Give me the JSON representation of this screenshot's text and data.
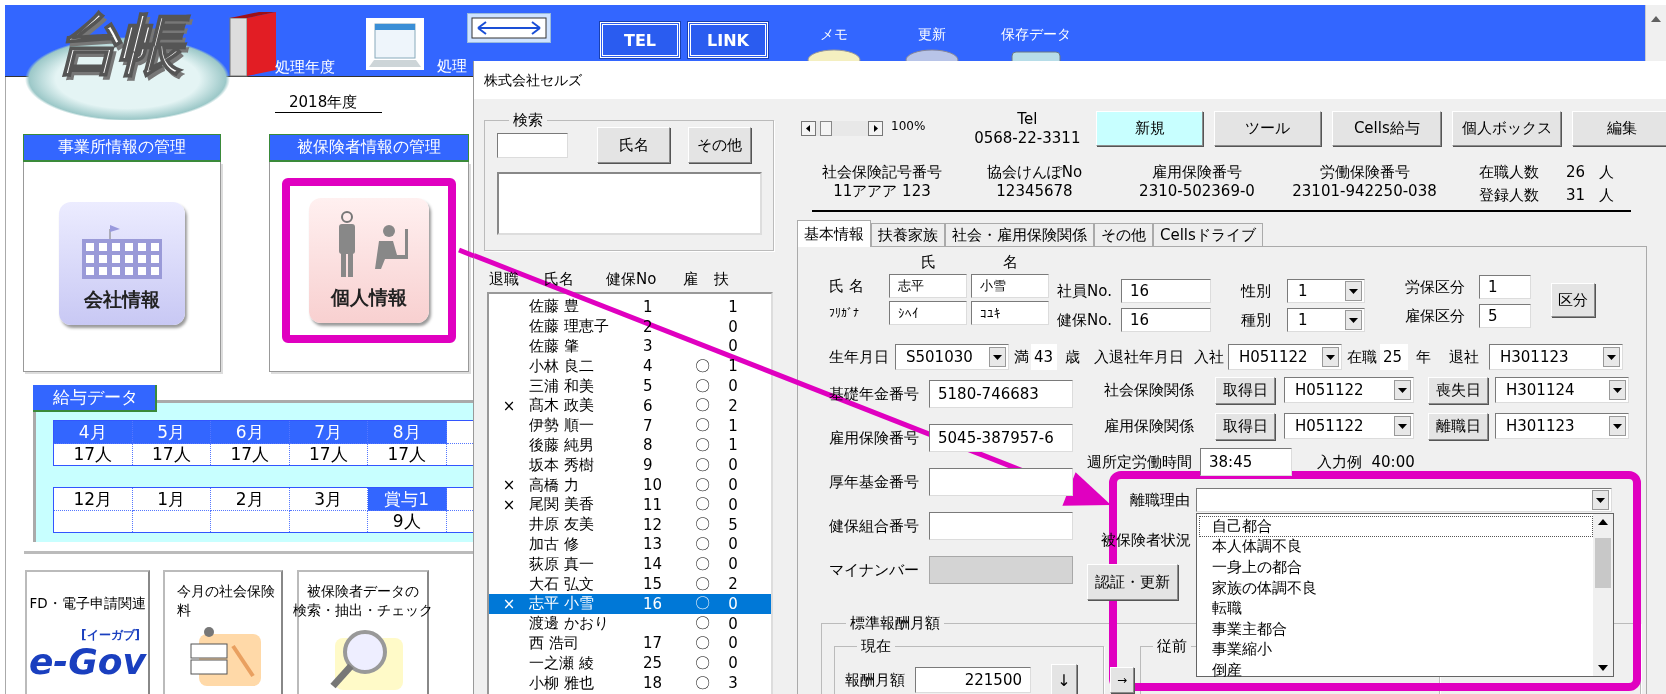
{
  "header": {
    "logo": "台帳",
    "year_label": "処理年度",
    "year_value": "2018年度",
    "ledger_label": "処理",
    "link_buttons": [
      "TEL",
      "LINK"
    ],
    "tools": [
      "メモ",
      "更新",
      "保存データ"
    ]
  },
  "management_cards": [
    {
      "title": "事業所情報の管理",
      "button": "会社情報",
      "kind": "company",
      "highlighted": false
    },
    {
      "title": "被保険者情報の管理",
      "button": "個人情報",
      "kind": "person",
      "highlighted": true
    }
  ],
  "salary_data": {
    "title": "給与データ",
    "tables": [
      {
        "cells": [
          {
            "month": "4月",
            "count": "17人",
            "highlighted": true
          },
          {
            "month": "5月",
            "count": "17人",
            "highlighted": true
          },
          {
            "month": "6月",
            "count": "17人",
            "highlighted": true
          },
          {
            "month": "7月",
            "count": "17人",
            "highlighted": true
          },
          {
            "month": "8月",
            "count": "17人",
            "highlighted": true
          }
        ]
      },
      {
        "cells": [
          {
            "month": "12月",
            "highlighted": false
          },
          {
            "month": "1月",
            "highlighted": false
          },
          {
            "month": "2月",
            "highlighted": false
          },
          {
            "month": "3月",
            "highlighted": false
          },
          {
            "month": "賞与1",
            "count": "9人",
            "highlighted": true
          }
        ]
      }
    ]
  },
  "menu_tiles": [
    {
      "label_lines": [
        "FD・電子申請関連"
      ],
      "kind": "egov",
      "logo": "e-Gov",
      "logo_reading": "[イーガブ]"
    },
    {
      "label_lines": [
        "今月の社会保険",
        "料"
      ],
      "kind": "premium"
    },
    {
      "label_lines": [
        "被保険者データの",
        "検索・抽出・チェック"
      ],
      "kind": "search"
    }
  ],
  "window": {
    "title": "株式会社セルズ",
    "search": {
      "label": "検索",
      "buttons": [
        "氏名",
        "その他"
      ]
    },
    "employee_list": {
      "columns": [
        "退職",
        "氏名",
        "健保No",
        "雇",
        "扶"
      ],
      "rows": [
        {
          "name": "佐藤 豊",
          "no": "1",
          "dependents": "1",
          "selected": false
        },
        {
          "name": "佐藤 理恵子",
          "no": "2",
          "dependents": "0",
          "selected": false
        },
        {
          "name": "佐藤 肇",
          "no": "3",
          "dependents": "0",
          "selected": false
        },
        {
          "name": "小林 良二",
          "no": "4",
          "employment": "〇",
          "dependents": "1",
          "selected": false
        },
        {
          "name": "三浦 和美",
          "no": "5",
          "employment": "〇",
          "dependents": "0",
          "selected": false
        },
        {
          "retired": "×",
          "name": "髙木 政美",
          "no": "6",
          "employment": "〇",
          "dependents": "2",
          "selected": false
        },
        {
          "name": "伊勢 順一",
          "no": "7",
          "employment": "〇",
          "dependents": "1",
          "selected": false
        },
        {
          "name": "後藤 純男",
          "no": "8",
          "employment": "〇",
          "dependents": "1",
          "selected": false
        },
        {
          "name": "坂本 秀樹",
          "no": "9",
          "employment": "〇",
          "dependents": "0",
          "selected": false
        },
        {
          "retired": "×",
          "name": "高橋 力",
          "no": "10",
          "employment": "〇",
          "dependents": "0",
          "selected": false
        },
        {
          "retired": "×",
          "name": "尾関 美香",
          "no": "11",
          "employment": "〇",
          "dependents": "0",
          "selected": false
        },
        {
          "name": "井原 友美",
          "no": "12",
          "employment": "〇",
          "dependents": "5",
          "selected": false
        },
        {
          "name": "加古 修",
          "no": "13",
          "employment": "〇",
          "dependents": "0",
          "selected": false
        },
        {
          "name": "荻原 真一",
          "no": "14",
          "employment": "〇",
          "dependents": "0",
          "selected": false
        },
        {
          "name": "大石 弘文",
          "no": "15",
          "employment": "〇",
          "dependents": "2",
          "selected": false
        },
        {
          "retired": "×",
          "name": "志平 小雪",
          "no": "16",
          "employment": "〇",
          "dependents": "0",
          "selected": true
        },
        {
          "name": "渡邊 かおり",
          "employment": "〇",
          "dependents": "0",
          "selected": false
        },
        {
          "name": "西 浩司",
          "no": "17",
          "employment": "〇",
          "dependents": "0",
          "selected": false
        },
        {
          "name": "一之瀬 綾",
          "no": "25",
          "employment": "〇",
          "dependents": "0",
          "selected": false
        },
        {
          "name": "小柳 雅也",
          "no": "18",
          "employment": "〇",
          "dependents": "3",
          "selected": false
        }
      ]
    },
    "zoom": "100%",
    "tel_label": "Tel",
    "tel": "0568-22-3311",
    "actions": [
      {
        "label": "新規",
        "highlighted": true
      },
      {
        "label": "ツール",
        "highlighted": false
      },
      {
        "label": "Cells給与",
        "highlighted": false
      },
      {
        "label": "個人ボックス",
        "highlighted": false
      },
      {
        "label": "編集",
        "highlighted": false
      }
    ],
    "summary": [
      {
        "label": "社会保険記号番号",
        "value": "11アアア 123"
      },
      {
        "label": "協会けんぽNo",
        "value": "12345678"
      },
      {
        "label": "雇用保険番号",
        "value": "2310-502369-0"
      },
      {
        "label": "労働保険番号",
        "value": "23101-942250-038"
      }
    ],
    "counts": [
      {
        "label": "在職人数",
        "value": "26",
        "unit": "人"
      },
      {
        "label": "登録人数",
        "value": "31",
        "unit": "人"
      }
    ],
    "tabs": [
      {
        "label": "基本情報",
        "selected": true
      },
      {
        "label": "扶養家族",
        "selected": false
      },
      {
        "label": "社会・雇用保険関係",
        "selected": false
      },
      {
        "label": "その他",
        "selected": false
      },
      {
        "label": "Cellsドライブ",
        "selected": false
      }
    ],
    "basic_info": {
      "name_headers": [
        "氏",
        "名"
      ],
      "name": {
        "label": "氏 名",
        "values": [
          "志平",
          "小雪"
        ]
      },
      "kana": {
        "label": "ﾌﾘｶﾞﾅ",
        "values": [
          "ｼﾍｲ",
          "ｺﾕｷ"
        ]
      },
      "ids": [
        {
          "label": "社員No.",
          "value": "16"
        },
        {
          "label": "健保No.",
          "value": "16"
        }
      ],
      "categories": [
        {
          "label": "性別",
          "value": "1"
        },
        {
          "label": "種別",
          "value": "1"
        }
      ],
      "classes": [
        {
          "label": "労保区分",
          "value": "1"
        },
        {
          "label": "雇保区分",
          "value": "5"
        }
      ],
      "class_button": "区分",
      "birth": {
        "label": "生年月日",
        "value": "S501030",
        "age_prefix": "満",
        "age": "43",
        "age_unit": "歳"
      },
      "employment_period": {
        "label": "入退社年月日",
        "join_label": "入社",
        "join": "H051122",
        "tenure_label": "在職",
        "tenure": "25",
        "tenure_unit": "年",
        "leave_label": "退社",
        "leave": "H301123"
      },
      "left_fields": [
        {
          "label": "基礎年金番号",
          "value": "5180-746683",
          "disabled": false
        },
        {
          "label": "雇用保険番号",
          "value": "5045-387957-6",
          "disabled": false
        },
        {
          "label": "厚年基金番号",
          "disabled": false
        },
        {
          "label": "健保組合番号",
          "disabled": false
        },
        {
          "label": "マイナンバー",
          "disabled": true
        }
      ],
      "insurance_relations": [
        {
          "label": "社会保険関係",
          "acquired_button": "取得日",
          "acquired": "H051122",
          "end_button": "喪失日",
          "end": "H301124"
        },
        {
          "label": "雇用保険関係",
          "acquired_button": "取得日",
          "acquired": "H051122",
          "end_button": "離職日",
          "end": "H301123"
        }
      ],
      "weekly_hours": {
        "label": "週所定労働時間",
        "value": "38:45",
        "example": "入力例  40:00"
      },
      "separation_reason": {
        "label": "離職理由",
        "options": [
          {
            "label": "自己都合",
            "selected": true
          },
          {
            "label": "本人体調不良",
            "selected": false
          },
          {
            "label": "一身上の都合",
            "selected": false
          },
          {
            "label": "家族の体調不良",
            "selected": false
          },
          {
            "label": "転職",
            "selected": false
          },
          {
            "label": "事業主都合",
            "selected": false
          },
          {
            "label": "事業縮小",
            "selected": false
          },
          {
            "label": "倒産",
            "selected": false
          }
        ]
      },
      "insured_status": {
        "label": "被保険者状況"
      },
      "verify_button": "認証・更新",
      "standard_pay": {
        "title": "標準報酬月額",
        "current": {
          "title": "現在",
          "label": "報酬月額",
          "value": "221500",
          "down_button": "↓"
        },
        "next_button": "→",
        "previous": {
          "title": "従前"
        }
      }
    }
  }
}
